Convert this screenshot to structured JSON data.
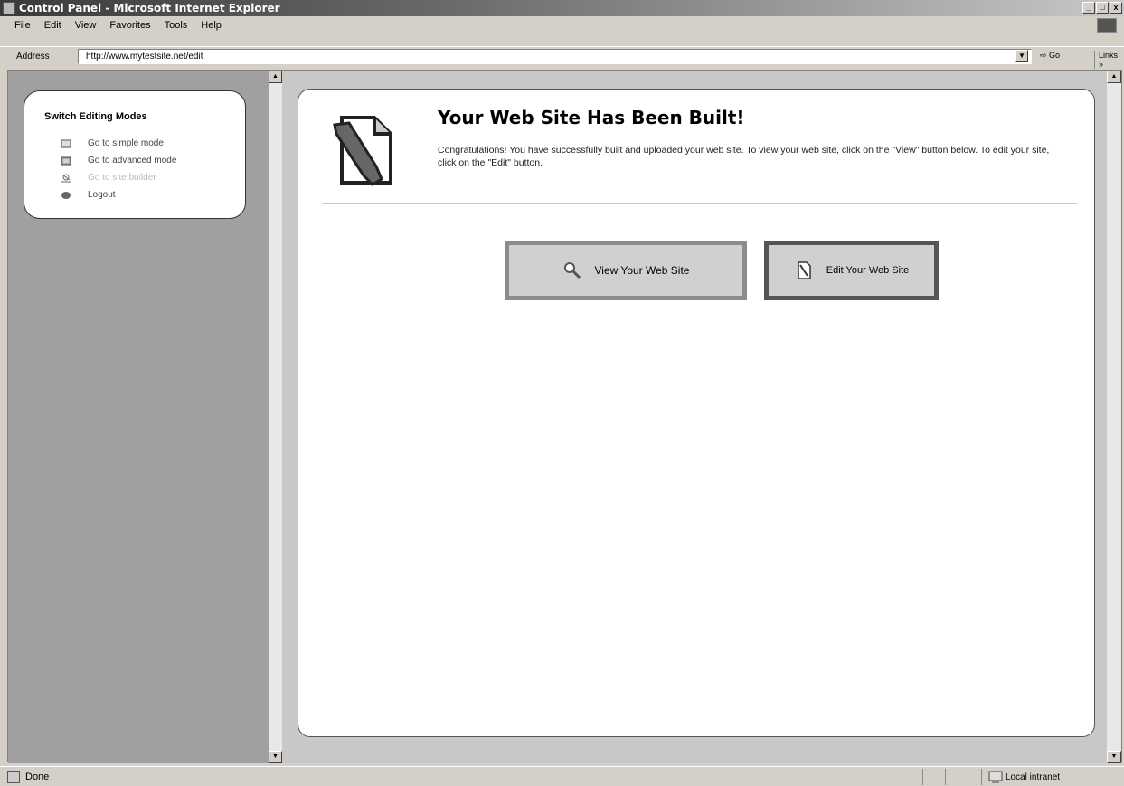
{
  "window": {
    "title": "Control Panel - Microsoft Internet Explorer",
    "buttons": [
      "_",
      "□",
      "x"
    ]
  },
  "menu": [
    "File",
    "Edit",
    "View",
    "Favorites",
    "Tools",
    "Help"
  ],
  "address": {
    "label": "Address",
    "url": "http://www.mytestsite.net/edit",
    "go_label": "Go",
    "links_label": "Links »"
  },
  "sidebar": {
    "title": "Switch Editing Modes",
    "items": [
      {
        "label": "Go to simple mode",
        "icon": "simple-mode-icon",
        "enabled": true
      },
      {
        "label": "Go to advanced mode",
        "icon": "advanced-mode-icon",
        "enabled": true
      },
      {
        "label": "Go to site builder",
        "icon": "site-builder-icon",
        "enabled": false
      },
      {
        "label": "Logout",
        "icon": "logout-icon",
        "enabled": true
      }
    ]
  },
  "main": {
    "title": "Your Web Site Has Been Built!",
    "description": "Congratulations! You have successfully built and uploaded your web site. To view your web site, click on the \"View\" button below. To edit your site, click on the \"Edit\" button.",
    "view_button": "View Your Web Site",
    "edit_button": "Edit Your Web Site"
  },
  "status": {
    "text": "Done",
    "zone": "Local intranet"
  }
}
